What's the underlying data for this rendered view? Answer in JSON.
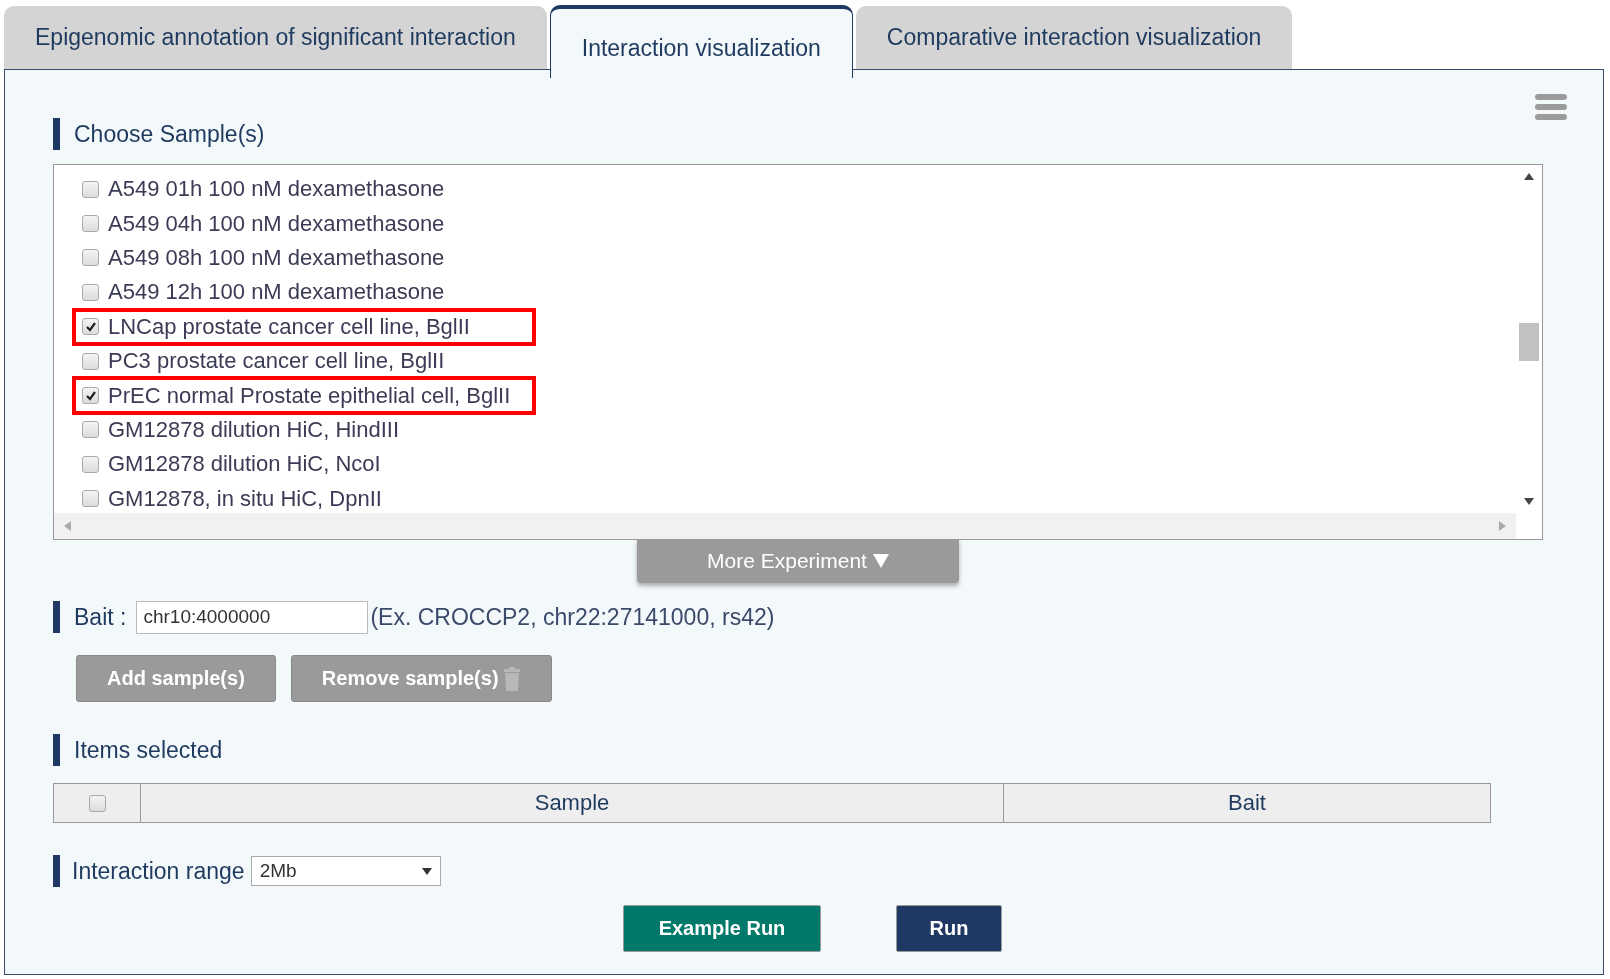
{
  "tabs": [
    {
      "label": "Epigenomic annotation of significant interaction",
      "selected": false
    },
    {
      "label": "Interaction visualization",
      "selected": true
    },
    {
      "label": "Comparative interaction visualization",
      "selected": false
    }
  ],
  "choose_samples": {
    "heading": "Choose Sample(s)",
    "items": [
      {
        "label": "A549 01h 100 nM dexamethasone",
        "checked": false,
        "highlighted": false
      },
      {
        "label": "A549 04h 100 nM dexamethasone",
        "checked": false,
        "highlighted": false
      },
      {
        "label": "A549 08h 100 nM dexamethasone",
        "checked": false,
        "highlighted": false
      },
      {
        "label": "A549 12h 100 nM dexamethasone",
        "checked": false,
        "highlighted": false
      },
      {
        "label": "LNCap prostate cancer cell line, BglII",
        "checked": true,
        "highlighted": true
      },
      {
        "label": "PC3 prostate cancer cell line, BglII",
        "checked": false,
        "highlighted": false
      },
      {
        "label": "PrEC normal Prostate epithelial cell, BglII",
        "checked": true,
        "highlighted": true
      },
      {
        "label": "GM12878 dilution HiC, HindIII",
        "checked": false,
        "highlighted": false
      },
      {
        "label": "GM12878 dilution HiC, NcoI",
        "checked": false,
        "highlighted": false
      },
      {
        "label": "GM12878, in situ HiC, DpnII",
        "checked": false,
        "highlighted": false
      }
    ],
    "more_button": "More Experiment"
  },
  "bait": {
    "label": "Bait :",
    "value": "chr10:4000000",
    "hint": "(Ex. CROCCP2, chr22:27141000, rs42)"
  },
  "buttons": [
    "Add sample(s)",
    "Remove sample(s)"
  ],
  "items_selected": {
    "heading": "Items selected",
    "select_all_checked": false,
    "columns": [
      "Sample",
      "Bait"
    ]
  },
  "interaction_range": {
    "label": "Interaction range",
    "value": "2Mb"
  },
  "run_buttons": [
    {
      "label": "Example Run",
      "kind": "example"
    },
    {
      "label": "Run",
      "kind": "run"
    }
  ]
}
